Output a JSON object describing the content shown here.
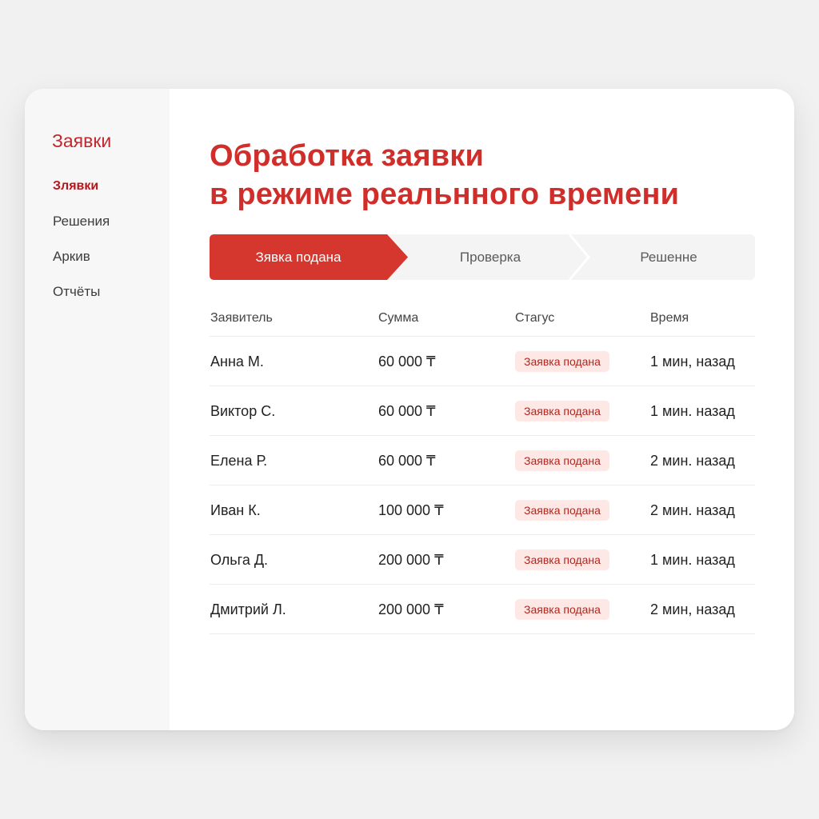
{
  "colors": {
    "accent": "#d02e2a",
    "accent_dark": "#b3161c",
    "badge_bg": "#fde8e6",
    "sidebar_bg": "#f7f7f7"
  },
  "sidebar": {
    "title": "Заявки",
    "items": [
      {
        "label": "Злявки",
        "active": true
      },
      {
        "label": "Решения",
        "active": false
      },
      {
        "label": "Аркив",
        "active": false
      },
      {
        "label": "Отчёты",
        "active": false
      }
    ]
  },
  "main": {
    "heading_line1": "Обработка заявки",
    "heading_line2": "в режиме реальнного времени",
    "steps": [
      {
        "label": "Зявка подана",
        "active": true
      },
      {
        "label": "Проверка",
        "active": false
      },
      {
        "label": "Решенне",
        "active": false
      }
    ],
    "table": {
      "headers": [
        "Заявитель",
        "Сумма",
        "Стагус",
        "Время"
      ],
      "rows": [
        {
          "name": "Анна М.",
          "amount": "60 000 ₸",
          "status": "Заявка подана",
          "time": "1 мин, назад"
        },
        {
          "name": "Виктор С.",
          "amount": "60 000 ₸",
          "status": "Заявка подана",
          "time": "1 мин. назад"
        },
        {
          "name": "Елена Р.",
          "amount": "60 000 ₸",
          "status": "Заявка подана",
          "time": "2 мин. назад"
        },
        {
          "name": "Иван К.",
          "amount": "100 000 ₸",
          "status": "Заявка подана",
          "time": "2 мин. назад"
        },
        {
          "name": "Ольга Д.",
          "amount": "200 000 ₸",
          "status": "Заявка подана",
          "time": "1 мин. назад"
        },
        {
          "name": "Дмитрий Л.",
          "amount": "200 000 ₸",
          "status": "Заявка подана",
          "time": "2 мин, назад"
        }
      ]
    }
  }
}
